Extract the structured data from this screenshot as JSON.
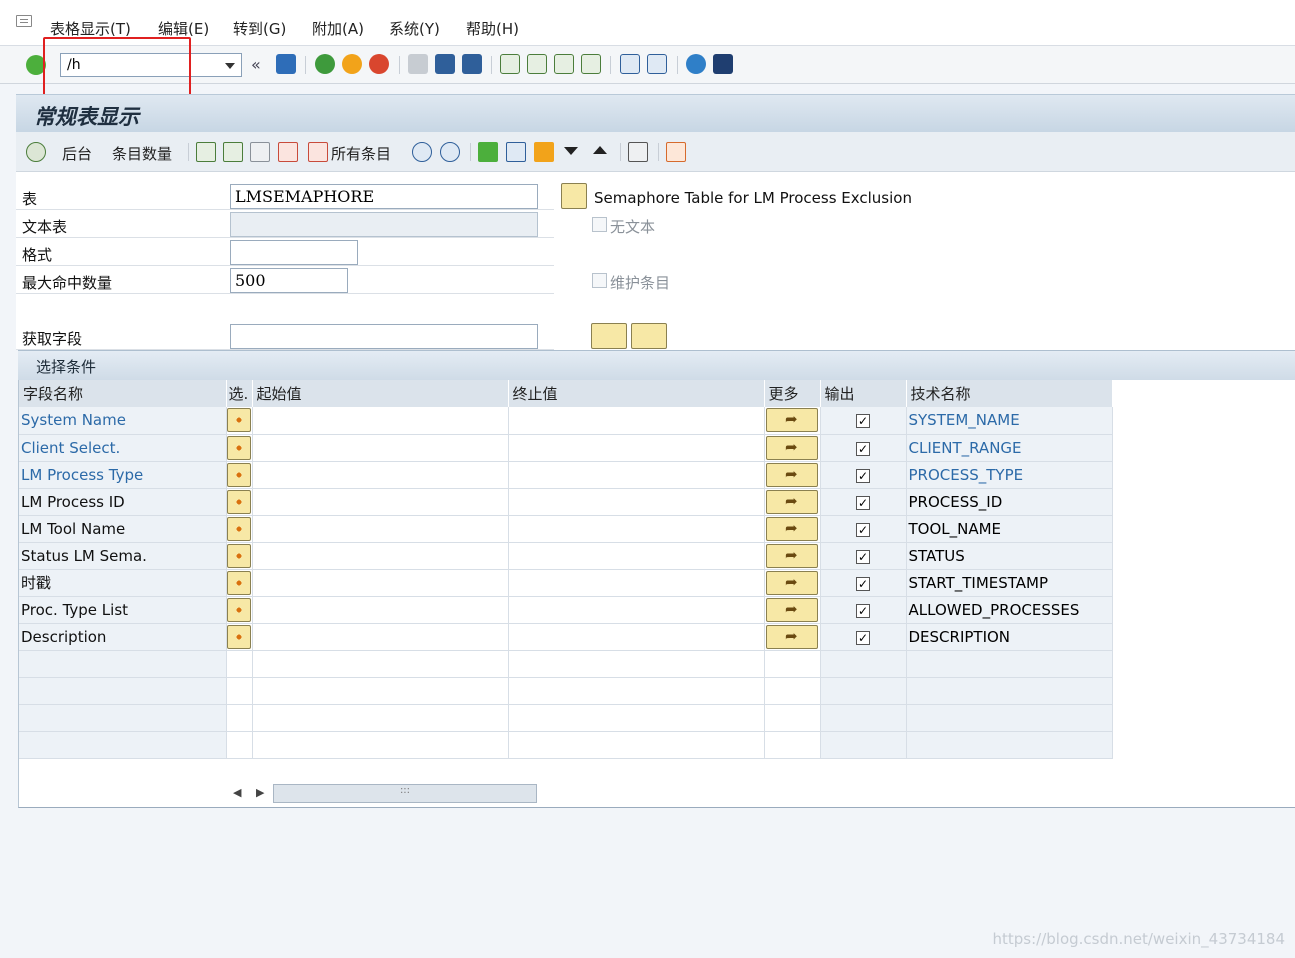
{
  "menu": {
    "items": [
      "表格显示(T)",
      "编辑(E)",
      "转到(G)",
      "附加(A)",
      "系统(Y)",
      "帮助(H)"
    ]
  },
  "toolbar": {
    "command_value": "/h"
  },
  "title": "常规表显示",
  "app_toolbar": {
    "background_label": "后台",
    "entry_count_label": "条目数量",
    "all_entries_label": "所有条目"
  },
  "form": {
    "table_label": "表",
    "table_value": "LMSEMAPHORE",
    "table_description": "Semaphore Table for LM Process Exclusion",
    "text_table_label": "文本表",
    "no_text_label": "无文本",
    "format_label": "格式",
    "max_hits_label": "最大命中数量",
    "max_hits_value": "500",
    "maintain_entries_label": "维护条目",
    "get_fields_label": "获取字段"
  },
  "selection": {
    "title": "选择条件",
    "headers": {
      "field_name": "字段名称",
      "sel": "选.",
      "from": "起始值",
      "to": "终止值",
      "more": "更多",
      "output": "输出",
      "tech_name": "技术名称"
    },
    "rows": [
      {
        "field": "System Name",
        "tech": "SYSTEM_NAME"
      },
      {
        "field": "Client Select.",
        "tech": "CLIENT_RANGE"
      },
      {
        "field": "LM Process Type",
        "tech": "PROCESS_TYPE"
      },
      {
        "field": "LM Process ID",
        "tech": "PROCESS_ID"
      },
      {
        "field": "LM Tool Name",
        "tech": "TOOL_NAME"
      },
      {
        "field": "Status LM Sema.",
        "tech": "STATUS"
      },
      {
        "field": "时戳",
        "tech": "START_TIMESTAMP"
      },
      {
        "field": "Proc. Type List",
        "tech": "ALLOWED_PROCESSES"
      },
      {
        "field": "Description",
        "tech": "DESCRIPTION"
      }
    ]
  },
  "scroll_grip": ":::",
  "watermark": "https://blog.csdn.net/weixin_43734184"
}
